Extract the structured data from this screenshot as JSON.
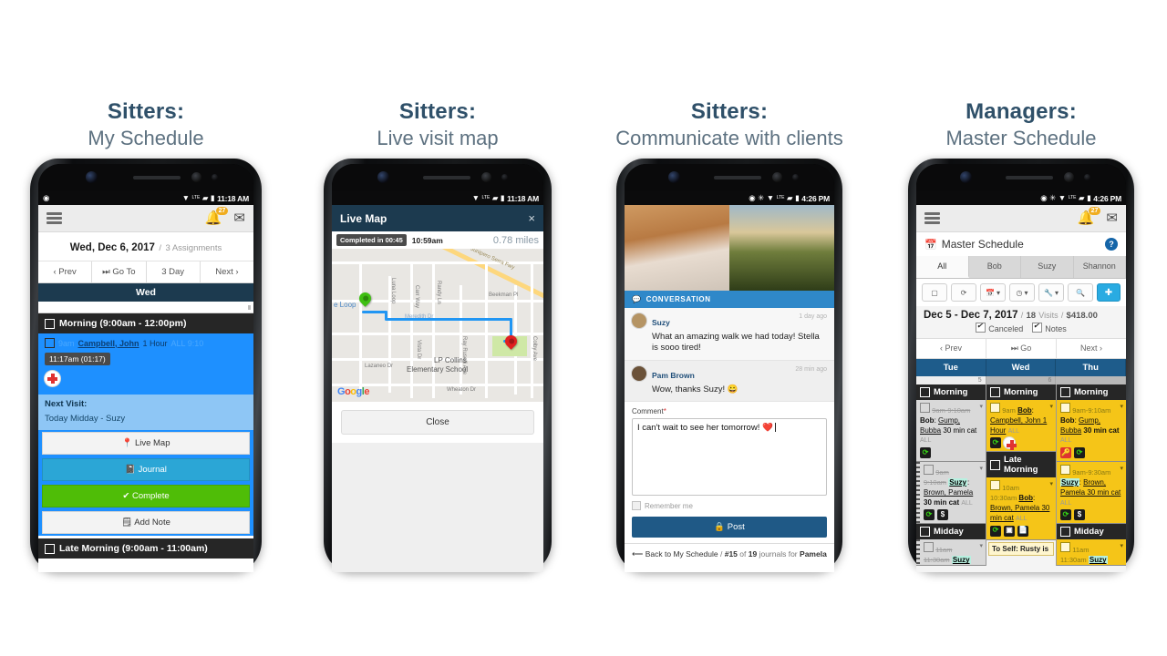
{
  "columns": [
    {
      "title": "Sitters:",
      "subtitle": "My Schedule"
    },
    {
      "title": "Sitters:",
      "subtitle": "Live visit map"
    },
    {
      "title": "Sitters:",
      "subtitle": "Communicate with clients"
    },
    {
      "title": "Managers:",
      "subtitle": "Master Schedule"
    }
  ],
  "phone1": {
    "status": {
      "time": "11:18 AM",
      "left_icon": "location-icon",
      "icons": [
        "wifi-icon",
        "lte-icon",
        "signal-icon",
        "battery-icon"
      ]
    },
    "appbar": {
      "menu": "menu-icon",
      "bell_badge": "27",
      "mail": "mail-icon"
    },
    "date_line": {
      "date": "Wed, Dec 6, 2017",
      "sep": "/",
      "assignments": "3 Assignments"
    },
    "nav": [
      "‹ Prev",
      "Go To",
      "3 Day",
      "Next ›"
    ],
    "day_bar": "Wed",
    "segment": "Morning (9:00am - 12:00pm)",
    "visit": {
      "time": "9am",
      "client": "Campbell, John",
      "duration": "1 Hour",
      "tail": "ALL 9:10",
      "timer": "11:17am (01:17)",
      "badge": "medical-icon"
    },
    "next_visit": {
      "label": "Next Visit:",
      "value": "Today Midday - Suzy"
    },
    "buttons": [
      {
        "label": "Live Map",
        "icon": "pin-icon",
        "style": "white"
      },
      {
        "label": "Journal",
        "icon": "journal-icon",
        "style": "cyan"
      },
      {
        "label": "Complete",
        "icon": "check-icon",
        "style": "green"
      },
      {
        "label": "Add Note",
        "icon": "note-icon",
        "style": "white"
      }
    ],
    "next_segment": "Late Morning (9:00am - 11:00am)"
  },
  "phone2": {
    "status": {
      "time": "11:18 AM"
    },
    "modal": {
      "title": "Live Map",
      "close": "×"
    },
    "map_bar": {
      "pill": "Completed in 00:45",
      "time": "10:59am",
      "distance": "0.78 miles"
    },
    "map_labels": [
      "Junipero Serra Fwy",
      "Beekman Pl",
      "Randy Ln",
      "Carr Way",
      "Luna Loop",
      "Vista Dr",
      "Lazaneo Dr",
      "Wheaton Dr",
      "Colby Ave",
      "Ray Ruselli Ave",
      "LP Collins",
      "Elementary School",
      "Meredith Dr",
      "e Loop"
    ],
    "watermark": "Google",
    "close_button": "Close"
  },
  "phone3": {
    "status": {
      "time": "4:26 PM"
    },
    "conversation_header": "CONVERSATION",
    "messages": [
      {
        "author": "Suzy",
        "ago": "1 day ago",
        "text": "What an amazing walk we had today! Stella is sooo tired!"
      },
      {
        "author": "Pam Brown",
        "ago": "28 min ago",
        "text": "Wow, thanks Suzy! 😀"
      }
    ],
    "comment": {
      "label": "Comment",
      "required": "*",
      "value": "I can't wait to see her tomorrow! ❤️"
    },
    "remember": "Remember me",
    "post_button": "Post",
    "footer": {
      "back": "Back to My Schedule",
      "sep": "/",
      "idx": "#15",
      "of": "of",
      "total": "19",
      "journals": "journals for",
      "pet": "Pamela"
    }
  },
  "phone4": {
    "status": {
      "time": "4:26 PM"
    },
    "appbar": {
      "bell_badge": "27"
    },
    "page_title": "Master Schedule",
    "help": "?",
    "tabs": [
      "All",
      "Bob",
      "Suzy",
      "Shannon"
    ],
    "toolbar": [
      "select-icon",
      "refresh-icon",
      "calendar-icon",
      "clock-icon",
      "wrench-icon",
      "search-icon",
      "add-icon"
    ],
    "date_range": {
      "range": "Dec 5 - Dec 7, 2017",
      "visits_num": "18",
      "visits_label": "Visits",
      "amount": "$418.00"
    },
    "filters": [
      "Canceled",
      "Notes"
    ],
    "pager": [
      "‹ Prev",
      "Go",
      "Next ›"
    ],
    "days": [
      "Tue",
      "Wed",
      "Thu"
    ],
    "counts": [
      "5",
      "6",
      ""
    ],
    "columns": [
      {
        "day": "Tue",
        "blocks": [
          {
            "head": "Morning",
            "cells": [
              {
                "bg": "gray",
                "time": "9am-9:10am",
                "canceled": true,
                "sitter": "Bob",
                "client": "Gump, Bubba",
                "detail": "30 min cat",
                "all": "ALL",
                "icons": [
                  "repeat"
                ]
              },
              {
                "bg": "gray",
                "time": "9am",
                "time2": "9:10am",
                "sitter": "Suzy",
                "client": "Brown, Pamela",
                "detail": "30 min cat",
                "all": "ALL",
                "icons": [
                  "repeat",
                  "money"
                ],
                "spiral": true
              }
            ]
          },
          {
            "head": "Midday",
            "cells": [
              {
                "bg": "gray",
                "time": "11am",
                "time2": "11:30am",
                "sitter": "Suzy",
                "client": "",
                "detail": "",
                "all": "",
                "icons": []
              }
            ]
          }
        ]
      },
      {
        "day": "Wed",
        "blocks": [
          {
            "head": "Morning",
            "cells": [
              {
                "bg": "yellow",
                "time": "9am",
                "sitter": "Bob",
                "client": "Campbell, John 1 Hour",
                "detail": "",
                "all": "ALL",
                "icons": [
                  "repeat",
                  "medical"
                ]
              }
            ]
          },
          {
            "head": "Late Morning",
            "cells": [
              {
                "bg": "yellow",
                "time": "10am",
                "time2": "10:30am",
                "sitter": "Bob",
                "client": "Brown, Pamela 30 min cat",
                "detail": "",
                "all": "ALL",
                "icons": [
                  "repeat",
                  "box",
                  "doc"
                ]
              },
              {
                "bg": "note",
                "note": "To Self: Rusty is"
              }
            ]
          }
        ]
      },
      {
        "day": "Thu",
        "blocks": [
          {
            "head": "Morning",
            "cells": [
              {
                "bg": "yellow",
                "time": "9am-9:10am",
                "sitter": "Bob",
                "client": "Gump, Bubba",
                "detail": "30 min cat",
                "all": "ALL",
                "icons": [
                  "key",
                  "repeat"
                ]
              },
              {
                "bg": "yellow",
                "time": "9am-9:30am",
                "sitter": "Suzy",
                "client": "Brown, Pamela 30 min cat",
                "detail": "",
                "all": "ALL",
                "icons": [
                  "repeat",
                  "money"
                ]
              }
            ]
          },
          {
            "head": "Midday",
            "cells": [
              {
                "bg": "yellow",
                "time": "11am",
                "time2": "11:30am",
                "sitter": "Suzy",
                "client": "",
                "detail": "",
                "all": "",
                "icons": []
              }
            ]
          }
        ]
      }
    ]
  }
}
